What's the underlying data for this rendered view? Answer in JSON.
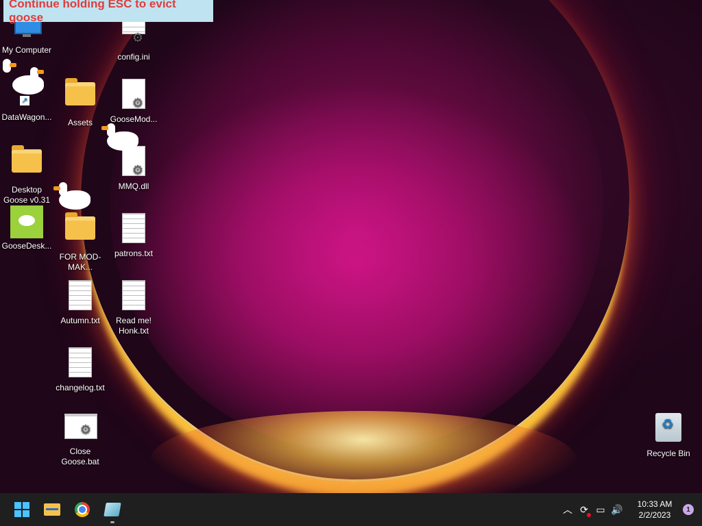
{
  "banner": {
    "text": "Continue holding ESC to evict goose"
  },
  "desktop": {
    "icons": [
      {
        "label": "My Computer"
      },
      {
        "label": "config.ini"
      },
      {
        "label": "DataWagon..."
      },
      {
        "label": "Assets"
      },
      {
        "label": "GooseMod..."
      },
      {
        "label": "Desktop Goose v0.31"
      },
      {
        "label": "MMQ.dll"
      },
      {
        "label": "GooseDesk..."
      },
      {
        "label": "FOR MOD-MAK..."
      },
      {
        "label": "patrons.txt"
      },
      {
        "label": "Autumn.txt"
      },
      {
        "label": "Read me! Honk.txt"
      },
      {
        "label": "changelog.txt"
      },
      {
        "label": "Close Goose.bat"
      },
      {
        "label": "Recycle Bin"
      }
    ]
  },
  "taskbar": {
    "apps": [
      "start-button",
      "file-explorer",
      "chrome",
      "desktop-goose"
    ],
    "clock": {
      "time": "10:33 AM",
      "date": "2/2/2023"
    },
    "notifications": "1"
  }
}
